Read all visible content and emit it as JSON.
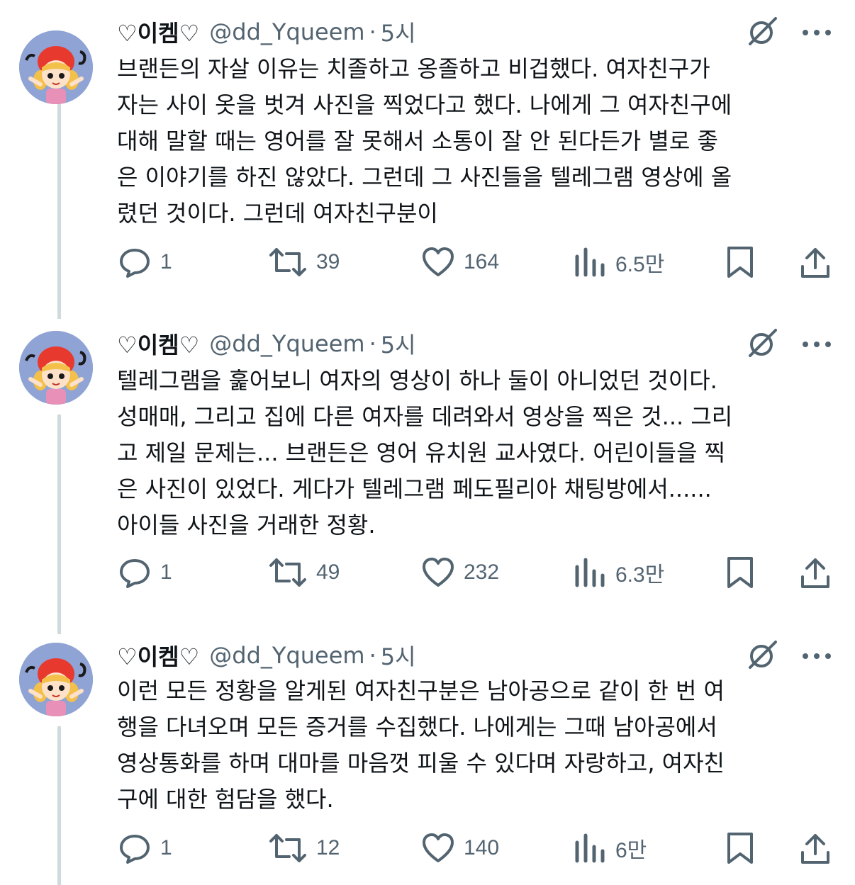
{
  "tweets": [
    {
      "name": "♡이켐♡",
      "handle": "@dd_Yqueem",
      "separator": "·",
      "time": "5시",
      "text": "브랜든의 자살 이유는 치졸하고 옹졸하고 비겁했다. 여자친구가\n자는 사이 옷을 벗겨 사진을 찍었다고 했다. 나에게 그 여자친구에\n대해 말할 때는 영어를 잘 못해서 소통이 잘 안 된다든가 별로 좋\n은 이야기를 하진 않았다. 그런데 그 사진들을 텔레그램 영상에 올\n렸던 것이다. 그런데 여자친구분이",
      "replies": "1",
      "retweets": "39",
      "likes": "164",
      "views": "6.5만"
    },
    {
      "name": "♡이켐♡",
      "handle": "@dd_Yqueem",
      "separator": "·",
      "time": "5시",
      "text": "텔레그램을 훑어보니 여자의 영상이 하나 둘이 아니었던 것이다.\n성매매, 그리고 집에 다른 여자를 데려와서 영상을 찍은 것... 그리\n고 제일 문제는... 브랜든은 영어 유치원 교사였다. 어린이들을 찍\n은 사진이 있었다. 게다가 텔레그램 페도필리아 채팅방에서......\n아이들 사진을 거래한 정황.",
      "replies": "1",
      "retweets": "49",
      "likes": "232",
      "views": "6.3만"
    },
    {
      "name": "♡이켐♡",
      "handle": "@dd_Yqueem",
      "separator": "·",
      "time": "5시",
      "text": "이런 모든 정황을 알게된 여자친구분은 남아공으로 같이 한 번 여\n행을 다녀오며 모든 증거를 수집했다. 나에게는 그때 남아공에서\n영상통화를 하며 대마를 마음껏 피울 수 있다며 자랑하고, 여자친\n구에 대한 험담을 했다.",
      "replies": "1",
      "retweets": "12",
      "likes": "140",
      "views": "6만"
    }
  ],
  "icons": {
    "avatar": "cartoon-girl-avatar",
    "grok": "grok-icon",
    "more": "more-dots-icon",
    "reply": "reply-bubble-icon",
    "retweet": "retweet-icon",
    "like": "heart-icon",
    "views": "views-bars-icon",
    "bookmark": "bookmark-icon",
    "share": "share-icon"
  },
  "colors": {
    "text": "#0f1419",
    "muted": "#536471",
    "thread_line": "#cfd9de",
    "avatar_bg": "#8fa3d4"
  }
}
